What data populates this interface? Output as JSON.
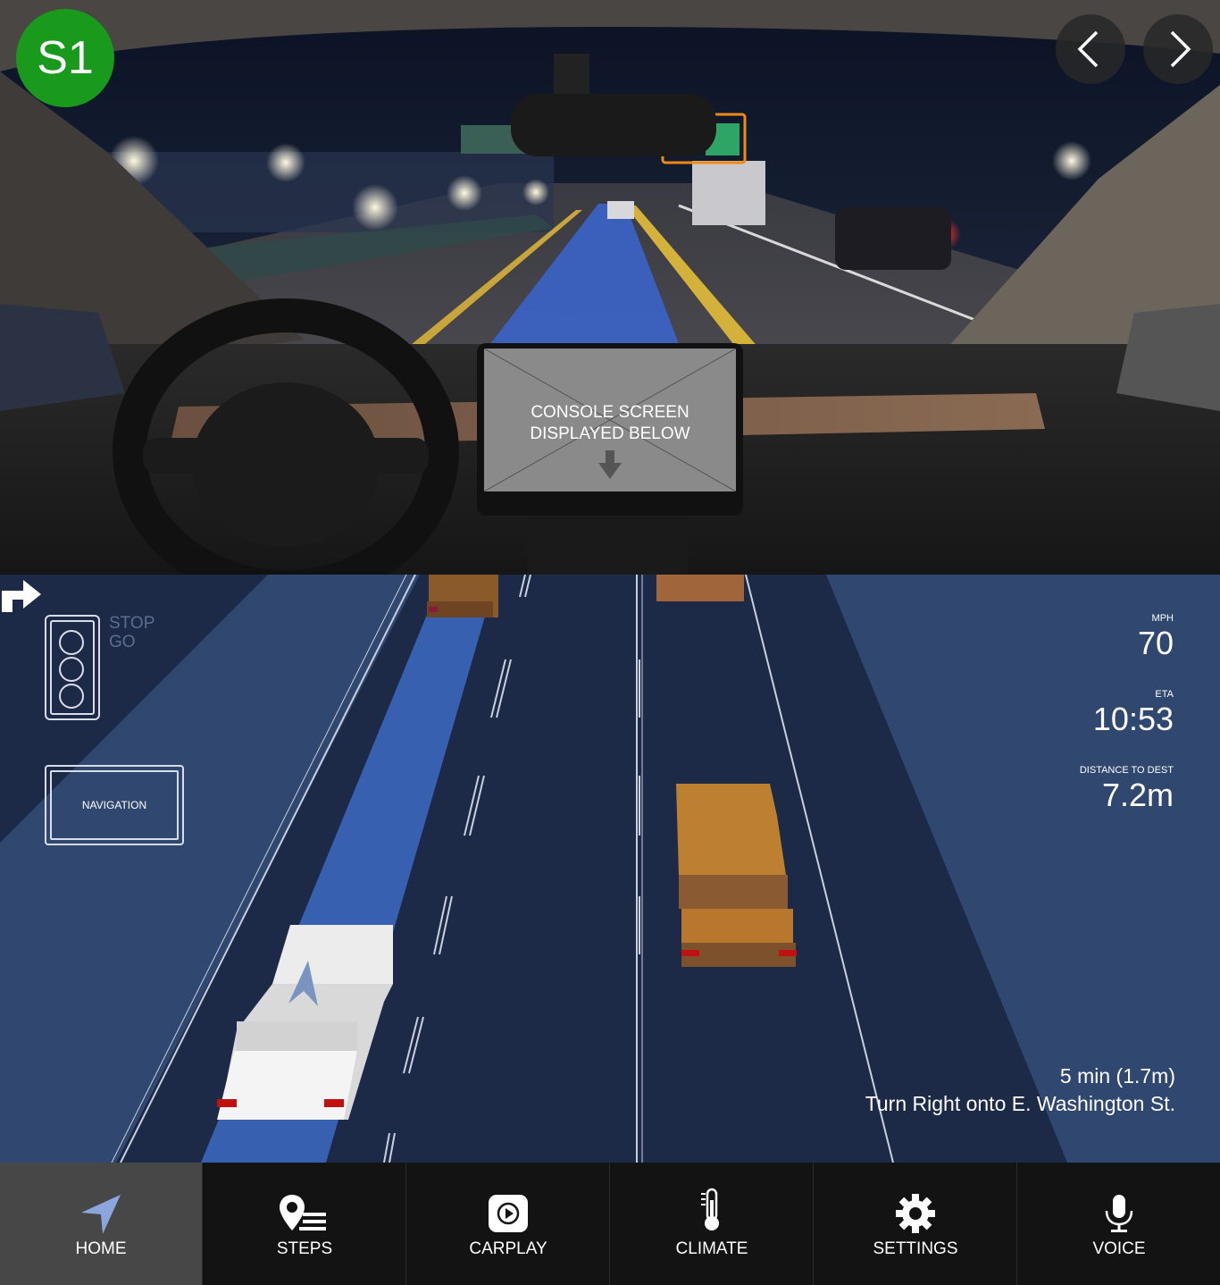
{
  "scene": {
    "badge": "S1",
    "console_text": "CONSOLE SCREEN\nDISPLAYED BELOW",
    "prev_icon": "chevron-left-icon",
    "next_icon": "chevron-right-icon"
  },
  "map": {
    "traffic_light": {
      "stop_label": "STOP",
      "go_label": "GO"
    },
    "navigation_label": "NAVIGATION",
    "mph_label": "MPH",
    "mph_value": "70",
    "eta_label": "ETA",
    "eta_value": "10:53",
    "distance_label": "DISTANCE TO DEST",
    "distance_value": "7.2m",
    "turn_icon": "turn-right-arrow-icon",
    "turn_time": "5 min (1.7m)",
    "turn_instruction": "Turn Right onto E. Washington St."
  },
  "tabs": [
    {
      "label": "HOME",
      "icon": "navigation-arrow-icon",
      "active": true
    },
    {
      "label": "STEPS",
      "icon": "map-pin-list-icon",
      "active": false
    },
    {
      "label": "CARPLAY",
      "icon": "carplay-icon",
      "active": false
    },
    {
      "label": "CLIMATE",
      "icon": "thermometer-icon",
      "active": false
    },
    {
      "label": "SETTINGS",
      "icon": "gear-icon",
      "active": false
    },
    {
      "label": "VOICE",
      "icon": "microphone-icon",
      "active": false
    }
  ],
  "colors": {
    "badge_green": "#199a1d",
    "route_blue": "#3f66b8",
    "map_dark": "#1d2a47",
    "map_light": "#30476f",
    "vehicle_orange": "#b77a2f",
    "active_tab": "#474747"
  }
}
